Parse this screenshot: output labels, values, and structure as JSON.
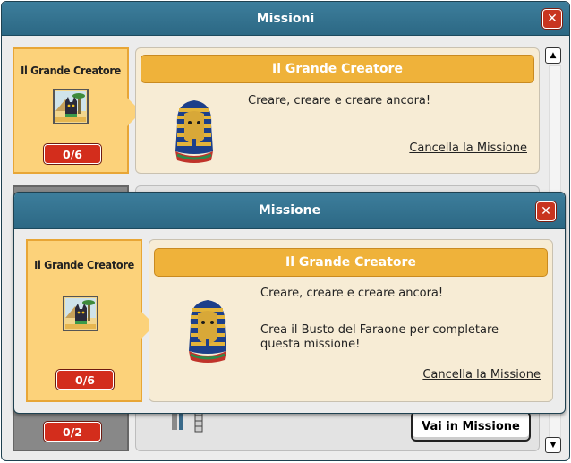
{
  "back_window": {
    "title": "Missioni",
    "close_glyph": "✕",
    "mission_card": {
      "name": "Il Grande Creatore",
      "progress": "0/6",
      "header": "Il Grande Creatore",
      "description": "Creare, creare e creare ancora!",
      "cancel_link": "Cancella la Missione"
    },
    "second_card": {
      "progress": "0/2",
      "go_button": "Vai in Missione"
    },
    "scroll_up_glyph": "▲",
    "scroll_down_glyph": "▼"
  },
  "front_window": {
    "title": "Missione",
    "close_glyph": "✕",
    "mission_card": {
      "name": "Il Grande Creatore",
      "progress": "0/6",
      "header": "Il Grande Creatore",
      "description": "Creare, creare e creare ancora!",
      "instruction": "Crea il Busto del Faraone per completare questa missione!",
      "cancel_link": "Cancella la Missione"
    }
  },
  "colors": {
    "titlebar": "#2c6884",
    "card_gold": "#fcd27a",
    "header_gold": "#efb23a",
    "badge_red": "#d32d1c",
    "close_red": "#c8341f"
  },
  "icons": [
    "close-icon",
    "mission-anubis-icon",
    "pharaoh-bust-icon",
    "scroll-up-icon",
    "scroll-down-icon",
    "mummy-figure-icon"
  ]
}
